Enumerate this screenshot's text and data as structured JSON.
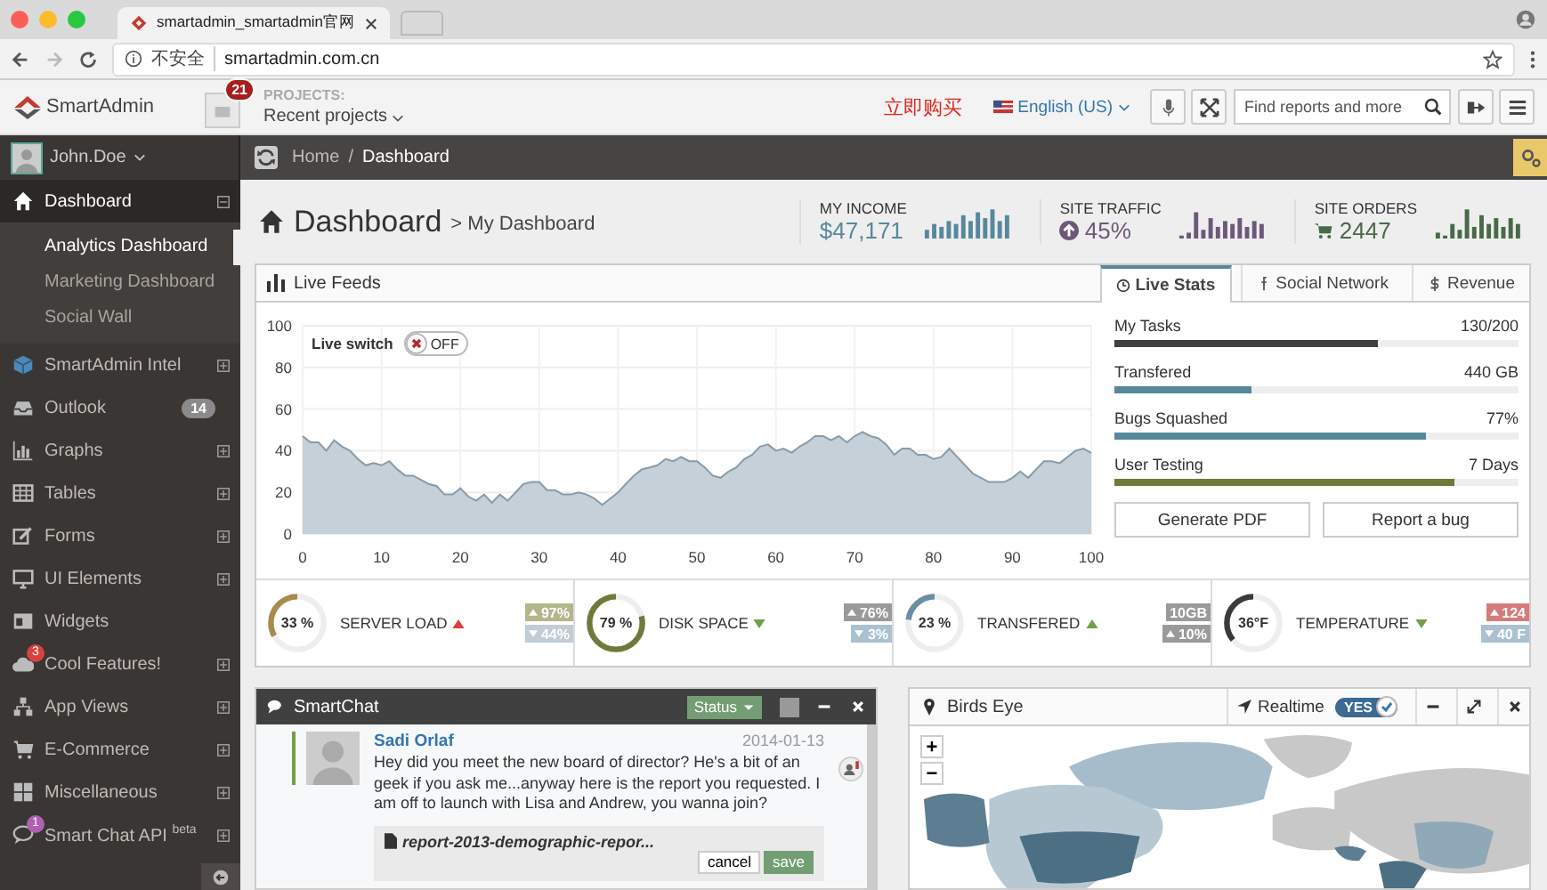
{
  "browser": {
    "tab_title": "smartadmin_smartadmin官网",
    "security": "不安全",
    "url": "smartadmin.com.cn"
  },
  "header": {
    "logo": "SmartAdmin",
    "notifications": "21",
    "projects_label": "PROJECTS:",
    "projects": "Recent projects",
    "promo": "立即购买",
    "language": "English (US)",
    "search": {
      "placeholder": "Find reports and more"
    }
  },
  "user": {
    "name": "John.Doe"
  },
  "breadcrumb": {
    "separator": "/",
    "items": [
      "Home",
      "Dashboard"
    ]
  },
  "sidebar": {
    "items": [
      {
        "label": "Dashboard",
        "kind": "group",
        "selected": true,
        "expanded": true,
        "children": [
          {
            "label": "Analytics Dashboard",
            "selected": true
          },
          {
            "label": "Marketing Dashboard",
            "selected": false
          },
          {
            "label": "Social Wall",
            "selected": false
          }
        ]
      },
      {
        "label": "SmartAdmin Intel",
        "kind": "group",
        "selected": false,
        "expanded": false
      },
      {
        "label": "Outlook",
        "kind": "link",
        "selected": false,
        "badge": {
          "text": "14",
          "kind": "pill",
          "color": "#8a8a8a"
        }
      },
      {
        "label": "Graphs",
        "kind": "group",
        "selected": false,
        "expanded": false
      },
      {
        "label": "Tables",
        "kind": "group",
        "selected": false,
        "expanded": false
      },
      {
        "label": "Forms",
        "kind": "group",
        "selected": false,
        "expanded": false
      },
      {
        "label": "UI Elements",
        "kind": "group",
        "selected": false,
        "expanded": false
      },
      {
        "label": "Widgets",
        "kind": "link",
        "selected": false
      },
      {
        "label": "Cool Features!",
        "kind": "group",
        "selected": false,
        "expanded": false,
        "badge": {
          "text": "3",
          "kind": "dot",
          "color": "#d9413f"
        }
      },
      {
        "label": "App Views",
        "kind": "group",
        "selected": false,
        "expanded": false
      },
      {
        "label": "E-Commerce",
        "kind": "group",
        "selected": false,
        "expanded": false
      },
      {
        "label": "Miscellaneous",
        "kind": "group",
        "selected": false,
        "expanded": false
      },
      {
        "label": "Smart Chat API $^{beta}$",
        "kind": "group",
        "selected": false,
        "expanded": false,
        "badge": {
          "text": "1",
          "kind": "dot",
          "color": "#b05fb3"
        }
      }
    ]
  },
  "page": {
    "title": "Dashboard",
    "subtitle": "> My Dashboard"
  },
  "stats": [
    {
      "label": "MY INCOME",
      "value": "$47,171",
      "kind": "income",
      "color": "#57889c"
    },
    {
      "label": "SITE TRAFFIC",
      "value": "45%",
      "kind": "traffic",
      "color": "#6e587a"
    },
    {
      "label": "SITE ORDERS",
      "value": "2447",
      "kind": "orders",
      "color": "#496949"
    }
  ],
  "live_feeds": {
    "title": "Live Feeds",
    "tabs": [
      {
        "label": "Live Stats",
        "selected": true
      },
      {
        "label": "Social Network",
        "selected": false
      },
      {
        "label": "Revenue",
        "selected": false
      }
    ],
    "live_switch": {
      "label": "Live switch",
      "text": "OFF",
      "on": false
    },
    "chart_data": {
      "type": "area",
      "grid": true,
      "xlim": [
        0,
        100
      ],
      "ylim": [
        0,
        100
      ],
      "xticks": [
        0,
        10,
        20,
        30,
        40,
        50,
        60,
        70,
        80,
        90,
        100
      ],
      "yticks": [
        0,
        20,
        40,
        60,
        80,
        100
      ],
      "x": [
        0,
        1,
        2,
        3,
        4,
        5,
        6,
        7,
        8,
        9,
        10,
        11,
        12,
        13,
        14,
        15,
        16,
        17,
        18,
        19,
        20,
        21,
        22,
        23,
        24,
        25,
        26,
        27,
        28,
        29,
        30,
        31,
        32,
        33,
        34,
        35,
        36,
        37,
        38,
        39,
        40,
        41,
        42,
        43,
        44,
        45,
        46,
        47,
        48,
        49,
        50,
        51,
        52,
        53,
        54,
        55,
        56,
        57,
        58,
        59,
        60,
        61,
        62,
        63,
        64,
        65,
        66,
        67,
        68,
        69,
        70,
        71,
        72,
        73,
        74,
        75,
        76,
        77,
        78,
        79,
        80,
        81,
        82,
        83,
        84,
        85,
        86,
        87,
        88,
        89,
        90,
        91,
        92,
        93,
        94,
        95,
        96,
        97,
        98,
        99,
        100
      ],
      "values": [
        47,
        44,
        44,
        40,
        45,
        42,
        40,
        36,
        33,
        34,
        33,
        35,
        31,
        28,
        28,
        26,
        24,
        23,
        19,
        19,
        22,
        18,
        16,
        19,
        15,
        19,
        16,
        20,
        24,
        25,
        25,
        21,
        21,
        19,
        19,
        20,
        19,
        17,
        14,
        17,
        20,
        24,
        28,
        31,
        32,
        33,
        36,
        35,
        37,
        35,
        35,
        32,
        28,
        27,
        30,
        32,
        36,
        38,
        42,
        43,
        40,
        41,
        39,
        42,
        44,
        47,
        47,
        45,
        47,
        44,
        47,
        49,
        47,
        46,
        43,
        38,
        41,
        41,
        38,
        38,
        36,
        37,
        41,
        37,
        33,
        29,
        27,
        25,
        25,
        25,
        27,
        30,
        27,
        31,
        35,
        35,
        34,
        37,
        40,
        41,
        39
      ]
    },
    "progress": [
      {
        "label": "My Tasks",
        "reading": "130/200",
        "level": 0.65,
        "color": "#404040"
      },
      {
        "label": "Transfered",
        "reading": "440 GB",
        "level": 0.34,
        "color": "#57889c"
      },
      {
        "label": "Bugs Squashed",
        "reading": "77%",
        "level": 0.77,
        "color": "#57889c"
      },
      {
        "label": "User Testing",
        "reading": "7 Days",
        "level": 0.84,
        "color": "#6f7a3a"
      }
    ],
    "buttons": [
      "Generate PDF",
      "Report a bug"
    ],
    "gauges": [
      {
        "reading": "33 %",
        "label": "SERVER LOAD",
        "level": 0.33,
        "color": "#a88c4f",
        "rising": true,
        "alert": true,
        "badges": [
          {
            "text": "97%",
            "kind": "up",
            "color": "#b3b78a"
          },
          {
            "text": "44%",
            "kind": "down",
            "color": "#c2ccd4"
          }
        ]
      },
      {
        "reading": "79 %",
        "label": "DISK SPACE",
        "level": 0.79,
        "color": "#6f7a3a",
        "rising": false,
        "alert": false,
        "badges": [
          {
            "text": "76%",
            "kind": "up",
            "color": "#9a9a9a"
          },
          {
            "text": "3%",
            "kind": "down",
            "color": "#a9c1d0"
          }
        ]
      },
      {
        "reading": "23 %",
        "label": "TRANSFERED",
        "level": 0.23,
        "color": "#6a8ea5",
        "rising": true,
        "alert": false,
        "badges": [
          {
            "text": "10GB",
            "kind": "plain",
            "color": "#9a9a9a"
          },
          {
            "text": "10%",
            "kind": "up",
            "color": "#9a9a9a"
          }
        ]
      },
      {
        "reading": "36°F",
        "label": "TEMPERATURE",
        "level": 0.36,
        "color": "#3a3a3a",
        "rising": false,
        "alert": false,
        "badges": [
          {
            "text": "124",
            "kind": "up",
            "color": "#d57b7b"
          },
          {
            "text": "40 F",
            "kind": "down",
            "color": "#a9c1d0"
          }
        ]
      }
    ]
  },
  "chat": {
    "title": "SmartChat",
    "status": "Status",
    "message": {
      "author": "Sadi Orlaf",
      "date": "2014-01-13",
      "text": "Hey did you meet the new board of director? He's a bit of an geek if you ask me...anyway here is the report you requested. I am off to launch with Lisa and Andrew, you wanna join?",
      "attachment": "report-2013-demographic-repor...",
      "actions": [
        "cancel",
        "save"
      ]
    }
  },
  "map": {
    "title": "Birds Eye",
    "realtime": "Realtime",
    "toggle": {
      "text": "YES",
      "on": true
    },
    "zoom": [
      "+",
      "−"
    ]
  }
}
